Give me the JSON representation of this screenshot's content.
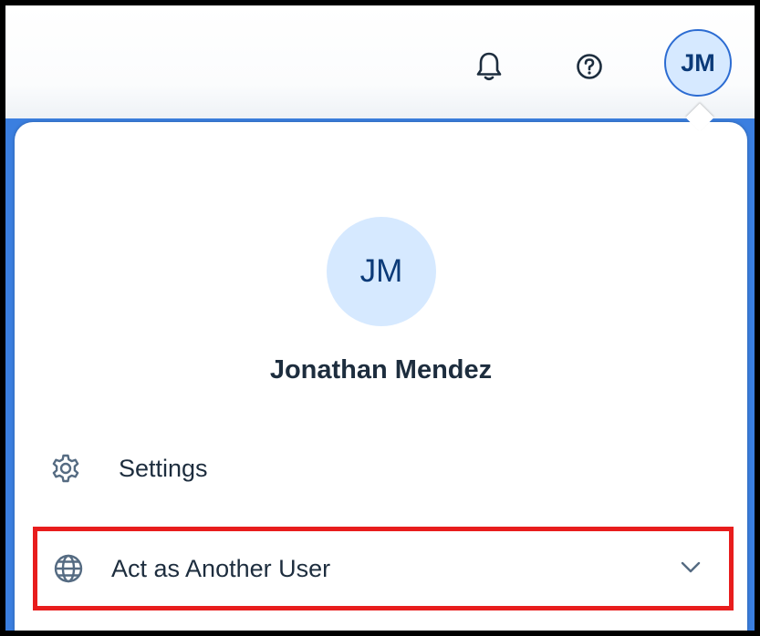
{
  "shellbar": {
    "notifications_icon": "bell-icon",
    "help_icon": "help-icon",
    "avatar_initials": "JM"
  },
  "profile_menu": {
    "avatar_initials": "JM",
    "user_name": "Jonathan Mendez",
    "items": [
      {
        "label": "Settings",
        "icon": "gear-icon"
      },
      {
        "label": "Act as Another User",
        "icon": "globe-icon",
        "trailing_icon": "chevron-down-icon"
      }
    ]
  },
  "colors": {
    "avatar_bg": "#d6e9ff",
    "avatar_text": "#0b3a78",
    "accent_blue": "#3b7fe0",
    "highlight_red": "#e81d1d",
    "text_primary": "#1d2d3e"
  }
}
